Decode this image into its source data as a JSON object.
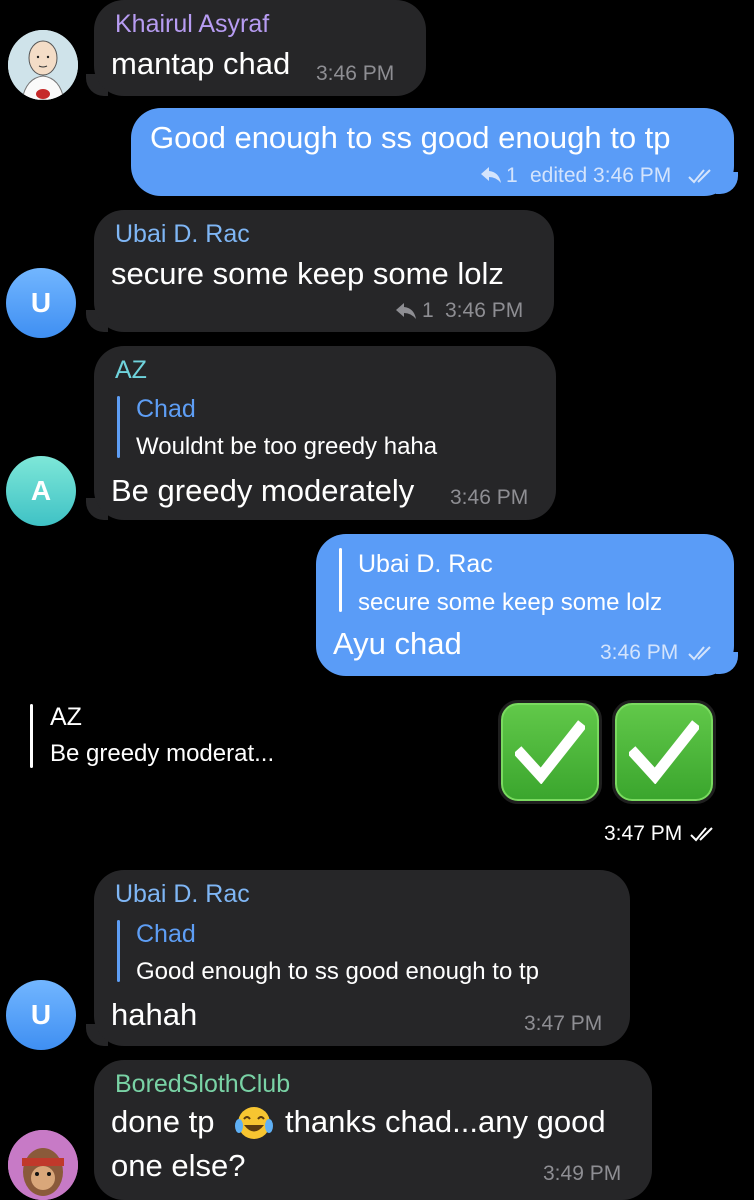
{
  "colors": {
    "background": "#000000",
    "incoming_bubble": "#262628",
    "outgoing_bubble": "#5a9cf7",
    "name_khairul": "#b79cf2",
    "name_ubai": "#7fb6f5",
    "name_az": "#6fd3dc",
    "name_bored": "#79d2a5",
    "time_incoming": "#8e8e93",
    "time_outgoing": "#d4e4fc",
    "reply_chad": "#5e9ef5"
  },
  "messages": [
    {
      "sender": "Khairul Asyraf",
      "text": "mantap chad",
      "time": "3:46 PM",
      "avatar_icon": "bald-man-avatar-icon"
    },
    {
      "text": "Good enough to ss good enough to tp",
      "reply_count": "1",
      "meta": "edited 3:46 PM",
      "status_icon": "double-check-icon"
    },
    {
      "sender": "Ubai D. Rac",
      "text": "secure some keep some lolz",
      "reply_count": "1",
      "time": "3:46 PM",
      "avatar_letter": "U"
    },
    {
      "sender": "AZ",
      "reply_name": "Chad",
      "reply_text": "Wouldnt be too greedy haha",
      "text": "Be greedy moderately",
      "time": "3:46 PM",
      "avatar_letter": "A"
    },
    {
      "reply_name": "Ubai D. Rac",
      "reply_text": "secure some keep some lolz",
      "text": "Ayu chad",
      "time": "3:46 PM",
      "status_icon": "double-check-icon"
    },
    {
      "reply_name": "AZ",
      "reply_text": "Be greedy moderat...",
      "emoji_icons": [
        "check-mark-button-icon",
        "check-mark-button-icon"
      ],
      "time": "3:47 PM",
      "status_icon": "double-check-icon"
    },
    {
      "sender": "Ubai D. Rac",
      "reply_name": "Chad",
      "reply_text": "Good enough to ss good enough to tp",
      "text": "hahah",
      "time": "3:47 PM",
      "avatar_letter": "U"
    },
    {
      "sender": "BoredSlothClub",
      "text_line1": "done tp",
      "text_line1b": "thanks chad...any good",
      "text_line2": "one else?",
      "emoji_icon": "tears-of-joy-icon",
      "time": "3:49 PM",
      "avatar_icon": "sloth-avatar-icon"
    }
  ]
}
